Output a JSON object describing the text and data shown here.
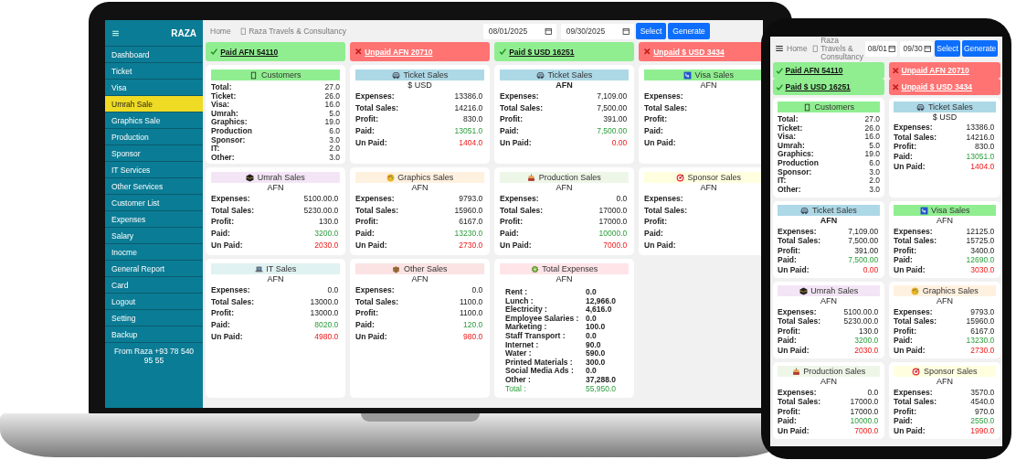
{
  "laptop": {
    "sidebar": {
      "brand": "RAZA",
      "items": [
        {
          "label": "Dashboard",
          "selected": false
        },
        {
          "label": "Ticket",
          "selected": false
        },
        {
          "label": "Visa",
          "selected": false
        },
        {
          "label": "Umrah Sale",
          "selected": true
        },
        {
          "label": "Graphics Sale",
          "selected": false
        },
        {
          "label": "Production",
          "selected": false
        },
        {
          "label": "Sponsor",
          "selected": false
        },
        {
          "label": "IT Services",
          "selected": false
        },
        {
          "label": "Other Services",
          "selected": false
        },
        {
          "label": "Customer List",
          "selected": false
        },
        {
          "label": "Expenses",
          "selected": false
        },
        {
          "label": "Salary",
          "selected": false
        },
        {
          "label": "Inocme",
          "selected": false
        },
        {
          "label": "General Report",
          "selected": false
        },
        {
          "label": "Card",
          "selected": false
        },
        {
          "label": "Logout",
          "selected": false
        },
        {
          "label": "Setting",
          "selected": false
        },
        {
          "label": "Backup",
          "selected": false
        }
      ],
      "footer": "From Raza +93 78 540 95 55"
    },
    "topbar": {
      "home": "Home",
      "breadcrumb": "Raza Travels & Consultancy",
      "start_date": "08/01/2025",
      "end_date": "09/30/2025",
      "buttons": [
        "Select",
        "Generate"
      ]
    },
    "status": [
      {
        "kind": "paid",
        "label": "Paid AFN 54110"
      },
      {
        "kind": "unpaid",
        "label": "Unpaid AFN 20710"
      },
      {
        "kind": "paid",
        "label": "Paid $ USD 16251"
      },
      {
        "kind": "unpaid",
        "label": "Unpaid $ USD 3434"
      }
    ],
    "cards": [
      {
        "kind": "customers",
        "title": "Customers",
        "color": "#90ee90",
        "rows": [
          {
            "label": "Total:",
            "value": "27.0"
          },
          {
            "label": "Ticket:",
            "value": "26.0"
          },
          {
            "label": "Visa:",
            "value": "16.0"
          },
          {
            "label": "Umrah:",
            "value": "5.0"
          },
          {
            "label": "Graphics:",
            "value": "19.0"
          },
          {
            "label": "Production",
            "value": "6.0"
          },
          {
            "label": "Sponsor:",
            "value": "3.0"
          },
          {
            "label": "IT:",
            "value": "2.0"
          },
          {
            "label": "Other:",
            "value": "3.0"
          }
        ]
      },
      {
        "kind": "ticket",
        "title": "Ticket Sales",
        "color": "#add8e6",
        "currency": "$ USD",
        "currency_bold": false,
        "rows": [
          {
            "label": "Expenses:",
            "value": "13386.0",
            "kind": "plain"
          },
          {
            "label": "Total Sales:",
            "value": "14216.0",
            "kind": "plain"
          },
          {
            "label": "Profit:",
            "value": "830.0",
            "kind": "plain"
          },
          {
            "label": "Paid:",
            "value": "13051.0",
            "kind": "paid"
          },
          {
            "label": "Un Paid:",
            "value": "1404.0",
            "kind": "unpaid"
          }
        ]
      },
      {
        "kind": "ticket",
        "title": "Ticket Sales",
        "color": "#add8e6",
        "currency": "AFN",
        "currency_bold": true,
        "rows": [
          {
            "label": "Expenses:",
            "value": "7,109.00",
            "kind": "plain"
          },
          {
            "label": "Total Sales:",
            "value": "7,500.00",
            "kind": "plain"
          },
          {
            "label": "Profit:",
            "value": "391.00",
            "kind": "plain"
          },
          {
            "label": "Paid:",
            "value": "7,500.00",
            "kind": "paid"
          },
          {
            "label": "Un Paid:",
            "value": "0.00",
            "kind": "unpaid"
          }
        ]
      },
      {
        "kind": "visa",
        "title": "Visa Sales",
        "color": "#90ee90",
        "currency": "AFN",
        "currency_bold": false,
        "rows": [
          {
            "label": "Expenses:"
          },
          {
            "label": "Total Sales:"
          },
          {
            "label": "Profit:"
          },
          {
            "label": "Paid:"
          },
          {
            "label": "Un Paid:"
          }
        ]
      },
      {
        "kind": "umrah",
        "title": "Umrah Sales",
        "color": "#f3e5f5",
        "currency": "AFN",
        "currency_bold": false,
        "rows": [
          {
            "label": "Expenses:",
            "value": "5100.00.0",
            "kind": "plain"
          },
          {
            "label": "Total Sales:",
            "value": "5230.00.0",
            "kind": "plain"
          },
          {
            "label": "Profit:",
            "value": "130.0",
            "kind": "plain"
          },
          {
            "label": "Paid:",
            "value": "3200.0",
            "kind": "paid"
          },
          {
            "label": "Un Paid:",
            "value": "2030.0",
            "kind": "unpaid"
          }
        ]
      },
      {
        "kind": "graphics",
        "title": "Graphics Sales",
        "color": "#fff1e0",
        "currency": "AFN",
        "currency_bold": false,
        "rows": [
          {
            "label": "Expenses:",
            "value": "9793.0",
            "kind": "plain"
          },
          {
            "label": "Total Sales:",
            "value": "15960.0",
            "kind": "plain"
          },
          {
            "label": "Profit:",
            "value": "6167.0",
            "kind": "plain"
          },
          {
            "label": "Paid:",
            "value": "13230.0",
            "kind": "paid"
          },
          {
            "label": "Un Paid:",
            "value": "2730.0",
            "kind": "unpaid"
          }
        ]
      },
      {
        "kind": "production",
        "title": "Production Sales",
        "color": "#eef6e8",
        "currency": "AFN",
        "currency_bold": false,
        "rows": [
          {
            "label": "Expenses:",
            "value": "0.0",
            "kind": "plain"
          },
          {
            "label": "Total Sales:",
            "value": "17000.0",
            "kind": "plain"
          },
          {
            "label": "Profit:",
            "value": "17000.0",
            "kind": "plain"
          },
          {
            "label": "Paid:",
            "value": "10000.0",
            "kind": "paid"
          },
          {
            "label": "Un Paid:",
            "value": "7000.0",
            "kind": "unpaid"
          }
        ]
      },
      {
        "kind": "sponsor",
        "title": "Sponsor Sales",
        "color": "#ffffe0",
        "currency": "AFN",
        "currency_bold": false,
        "rows": [
          {
            "label": "Expenses:"
          },
          {
            "label": "Total Sales:"
          },
          {
            "label": "Profit:"
          },
          {
            "label": "Paid:"
          },
          {
            "label": "Un Paid:"
          }
        ]
      },
      {
        "kind": "it",
        "title": "IT Sales",
        "color": "#e0f2f1",
        "currency": "AFN",
        "currency_bold": false,
        "rows": [
          {
            "label": "Expenses:",
            "value": "0.0",
            "kind": "plain"
          },
          {
            "label": "Total Sales:",
            "value": "13000.0",
            "kind": "plain"
          },
          {
            "label": "Profit:",
            "value": "13000.0",
            "kind": "plain"
          },
          {
            "label": "Paid:",
            "value": "8020.0",
            "kind": "paid"
          },
          {
            "label": "Un Paid:",
            "value": "4980.0",
            "kind": "unpaid"
          }
        ]
      },
      {
        "kind": "other",
        "title": "Other Sales",
        "color": "#fbe3e3",
        "currency": "AFN",
        "currency_bold": false,
        "rows": [
          {
            "label": "Expenses:",
            "value": "0.0",
            "kind": "plain"
          },
          {
            "label": "Total Sales:",
            "value": "1100.0",
            "kind": "plain"
          },
          {
            "label": "Profit:",
            "value": "1100.0",
            "kind": "plain"
          },
          {
            "label": "Paid:",
            "value": "120.0",
            "kind": "paid"
          },
          {
            "label": "Un Paid:",
            "value": "980.0",
            "kind": "unpaid"
          }
        ]
      },
      {
        "kind": "expenses",
        "title": "Total Expenses",
        "color": "#ffe4e8",
        "currency": "AFN",
        "currency_bold": false,
        "rows": [
          {
            "label": "Rent :",
            "value": "0.0",
            "kind": "plain"
          },
          {
            "label": "Lunch :",
            "value": "12,966.0",
            "kind": "plain"
          },
          {
            "label": "Electricity :",
            "value": "4,616.0",
            "kind": "plain"
          },
          {
            "label": "Employee Salaries :",
            "value": "0.0",
            "kind": "plain"
          },
          {
            "label": "Marketing :",
            "value": "100.0",
            "kind": "plain"
          },
          {
            "label": "Staff Transport :",
            "value": "0.0",
            "kind": "plain"
          },
          {
            "label": "Internet :",
            "value": "90.0",
            "kind": "plain"
          },
          {
            "label": "Water :",
            "value": "590.0",
            "kind": "plain"
          },
          {
            "label": "Printed Materials :",
            "value": "300.0",
            "kind": "plain"
          },
          {
            "label": "Social Media Ads :",
            "value": "0.0",
            "kind": "plain"
          },
          {
            "label": "Other :",
            "value": "37,288.0",
            "kind": "plain"
          },
          {
            "label": "Total :",
            "value": "55,950.0",
            "kind": "total"
          }
        ]
      }
    ]
  },
  "phone": {
    "topbar": {
      "home": "Home",
      "breadcrumb": "Raza Travels & Consultancy",
      "start_date": "08/01",
      "end_date": "09/30",
      "buttons": [
        "Select",
        "Generate"
      ]
    },
    "status": [
      {
        "kind": "paid",
        "label": "Paid AFN 54110"
      },
      {
        "kind": "unpaid",
        "label": "Unpaid AFN 20710"
      },
      {
        "kind": "paid",
        "label": "Paid $ USD 16251"
      },
      {
        "kind": "unpaid",
        "label": "Unpaid $ USD 3434"
      }
    ],
    "cards": [
      {
        "kind": "customers",
        "title": "Customers",
        "color": "#90ee90",
        "rows": [
          {
            "label": "Total:",
            "value": "27.0"
          },
          {
            "label": "Ticket:",
            "value": "26.0"
          },
          {
            "label": "Visa:",
            "value": "16.0"
          },
          {
            "label": "Umrah:",
            "value": "5.0"
          },
          {
            "label": "Graphics:",
            "value": "19.0"
          },
          {
            "label": "Production",
            "value": "6.0"
          },
          {
            "label": "Sponsor:",
            "value": "3.0"
          },
          {
            "label": "IT:",
            "value": "2.0"
          },
          {
            "label": "Other:",
            "value": "3.0"
          }
        ]
      },
      {
        "kind": "ticket",
        "title": "Ticket Sales",
        "color": "#add8e6",
        "currency": "$ USD",
        "currency_bold": false,
        "rows": [
          {
            "label": "Expenses:",
            "value": "13386.0",
            "kind": "plain"
          },
          {
            "label": "Total Sales:",
            "value": "14216.0",
            "kind": "plain"
          },
          {
            "label": "Profit:",
            "value": "830.0",
            "kind": "plain"
          },
          {
            "label": "Paid:",
            "value": "13051.0",
            "kind": "paid"
          },
          {
            "label": "Un Paid:",
            "value": "1404.0",
            "kind": "unpaid"
          }
        ]
      },
      {
        "kind": "ticket",
        "title": "Ticket Sales",
        "color": "#add8e6",
        "currency": "AFN",
        "currency_bold": true,
        "rows": [
          {
            "label": "Expenses:",
            "value": "7,109.00",
            "kind": "plain"
          },
          {
            "label": "Total Sales:",
            "value": "7,500.00",
            "kind": "plain"
          },
          {
            "label": "Profit:",
            "value": "391.00",
            "kind": "plain"
          },
          {
            "label": "Paid:",
            "value": "7,500.00",
            "kind": "paid"
          },
          {
            "label": "Un Paid:",
            "value": "0.00",
            "kind": "unpaid"
          }
        ]
      },
      {
        "kind": "visa",
        "title": "Visa Sales",
        "color": "#90ee90",
        "currency": "AFN",
        "currency_bold": false,
        "rows": [
          {
            "label": "Expenses:",
            "value": "12125.0",
            "kind": "plain"
          },
          {
            "label": "Total Sales:",
            "value": "15725.0",
            "kind": "plain"
          },
          {
            "label": "Profit:",
            "value": "3400.0",
            "kind": "plain"
          },
          {
            "label": "Paid:",
            "value": "12690.0",
            "kind": "paid"
          },
          {
            "label": "Un Paid:",
            "value": "3030.0",
            "kind": "unpaid"
          }
        ]
      },
      {
        "kind": "umrah",
        "title": "Umrah Sales",
        "color": "#f3e5f5",
        "currency": "AFN",
        "currency_bold": false,
        "rows": [
          {
            "label": "Expenses:",
            "value": "5100.00.0",
            "kind": "plain"
          },
          {
            "label": "Total Sales:",
            "value": "5230.00.0",
            "kind": "plain"
          },
          {
            "label": "Profit:",
            "value": "130.0",
            "kind": "plain"
          },
          {
            "label": "Paid:",
            "value": "3200.0",
            "kind": "paid"
          },
          {
            "label": "Un Paid:",
            "value": "2030.0",
            "kind": "unpaid"
          }
        ]
      },
      {
        "kind": "graphics",
        "title": "Graphics Sales",
        "color": "#fff1e0",
        "currency": "AFN",
        "currency_bold": false,
        "rows": [
          {
            "label": "Expenses:",
            "value": "9793.0",
            "kind": "plain"
          },
          {
            "label": "Total Sales:",
            "value": "15960.0",
            "kind": "plain"
          },
          {
            "label": "Profit:",
            "value": "6167.0",
            "kind": "plain"
          },
          {
            "label": "Paid:",
            "value": "13230.0",
            "kind": "paid"
          },
          {
            "label": "Un Paid:",
            "value": "2730.0",
            "kind": "unpaid"
          }
        ]
      },
      {
        "kind": "production",
        "title": "Production Sales",
        "color": "#eef6e8",
        "currency": "AFN",
        "currency_bold": false,
        "rows": [
          {
            "label": "Expenses:",
            "value": "0.0",
            "kind": "plain"
          },
          {
            "label": "Total Sales:",
            "value": "17000.0",
            "kind": "plain"
          },
          {
            "label": "Profit:",
            "value": "17000.0",
            "kind": "plain"
          },
          {
            "label": "Paid:",
            "value": "10000.0",
            "kind": "paid"
          },
          {
            "label": "Un Paid:",
            "value": "7000.0",
            "kind": "unpaid"
          }
        ]
      },
      {
        "kind": "sponsor",
        "title": "Sponsor Sales",
        "color": "#ffffe0",
        "currency": "AFN",
        "currency_bold": false,
        "rows": [
          {
            "label": "Expenses:",
            "value": "3570.0",
            "kind": "plain"
          },
          {
            "label": "Total Sales:",
            "value": "4540.0",
            "kind": "plain"
          },
          {
            "label": "Profit:",
            "value": "970.0",
            "kind": "plain"
          },
          {
            "label": "Paid:",
            "value": "2550.0",
            "kind": "paid"
          },
          {
            "label": "Un Paid:",
            "value": "1990.0",
            "kind": "unpaid"
          }
        ]
      }
    ]
  }
}
